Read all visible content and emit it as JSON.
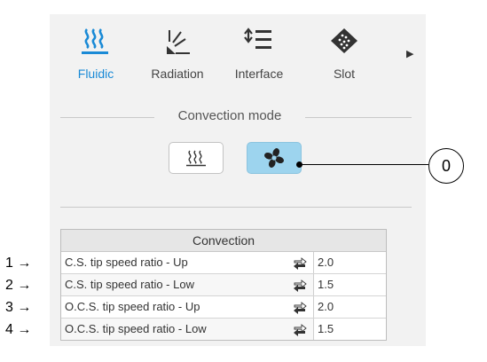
{
  "tabs": [
    {
      "label": "Fluidic",
      "icon": "fluidic-heat-icon",
      "active": true
    },
    {
      "label": "Radiation",
      "icon": "radiation-icon",
      "active": false
    },
    {
      "label": "Interface",
      "icon": "interface-icon",
      "active": false
    },
    {
      "label": "Slot",
      "icon": "slot-icon",
      "active": false
    }
  ],
  "convection_mode": {
    "title": "Convection mode",
    "buttons": [
      {
        "icon": "heat-waves-icon",
        "selected": false
      },
      {
        "icon": "fan-icon",
        "selected": true
      }
    ]
  },
  "table": {
    "header": "Convection",
    "rows": [
      {
        "name": "C.S. tip speed ratio - Up",
        "value": "2.0"
      },
      {
        "name": "C.S. tip speed ratio - Low",
        "value": "1.5"
      },
      {
        "name": "O.C.S. tip speed ratio - Up",
        "value": "2.0"
      },
      {
        "name": "O.C.S. tip speed ratio - Low",
        "value": "1.5"
      }
    ]
  },
  "annotations": {
    "rows": [
      "1",
      "2",
      "3",
      "4"
    ],
    "arrow": "→",
    "fan_callout": "0"
  },
  "colors": {
    "accent": "#1a8ad6",
    "selected_button": "#9dd4ee",
    "panel_background": "#f2f2f2"
  }
}
